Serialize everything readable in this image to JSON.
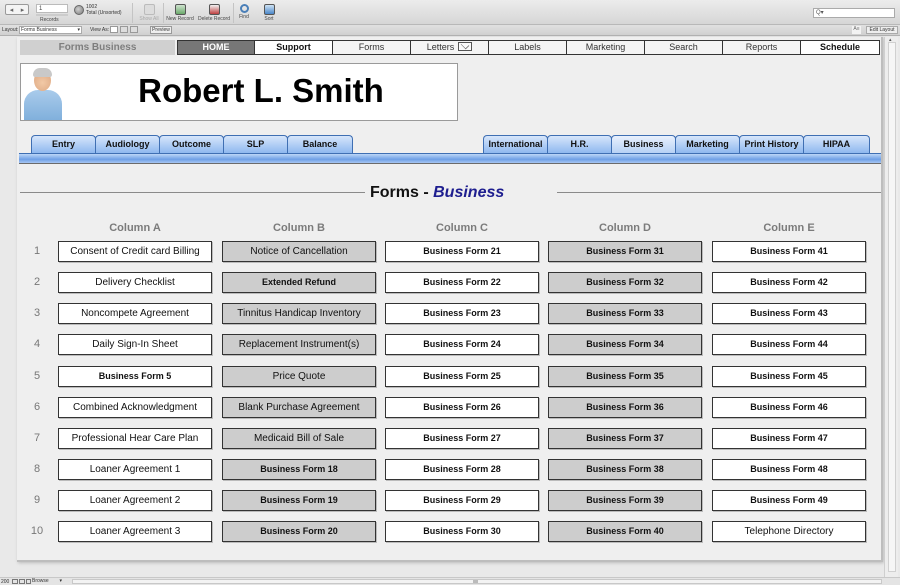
{
  "toolbar": {
    "record_number": "1",
    "records_label": "Records",
    "total_count": "1002",
    "total_status": "Total (Unsorted)",
    "buttons": [
      {
        "label": "Show All",
        "icon": "show-all-icon",
        "disabled": true
      },
      {
        "label": "New Record",
        "icon": "new-record-icon",
        "disabled": false
      },
      {
        "label": "Delete Record",
        "icon": "delete-record-icon",
        "disabled": false
      },
      {
        "label": "Find",
        "icon": "find-icon",
        "disabled": false
      },
      {
        "label": "Sort",
        "icon": "sort-icon",
        "disabled": false
      }
    ],
    "search_placeholder": "Q▾"
  },
  "layout_bar": {
    "layout_label": "Layout:",
    "layout_value": "Forms Business",
    "view_as_label": "View As:",
    "preview_label": "Preview",
    "aa_label": "A≡",
    "edit_layout_label": "Edit Layout"
  },
  "nav": {
    "title": "Forms Business",
    "items": [
      {
        "label": "HOME"
      },
      {
        "label": "Support"
      },
      {
        "label": "Forms"
      },
      {
        "label": "Letters"
      },
      {
        "label": "Labels"
      },
      {
        "label": "Marketing"
      },
      {
        "label": "Search"
      },
      {
        "label": "Reports"
      },
      {
        "label": "Schedule"
      }
    ]
  },
  "patient": {
    "name": "Robert L. Smith"
  },
  "tabs_left": [
    {
      "label": "Entry"
    },
    {
      "label": "Audiology"
    },
    {
      "label": "Outcome"
    },
    {
      "label": "SLP"
    },
    {
      "label": "Balance"
    }
  ],
  "tabs_right": [
    {
      "label": "International"
    },
    {
      "label": "H.R."
    },
    {
      "label": "Business",
      "active": true
    },
    {
      "label": "Marketing"
    },
    {
      "label": "Print History"
    },
    {
      "label": "HIPAA"
    }
  ],
  "section": {
    "title_prefix": "Forms - ",
    "title_accent": "Business",
    "accent_color": "#1e1e8f"
  },
  "grid": {
    "columns": [
      "Column A",
      "Column B",
      "Column C",
      "Column D",
      "Column E"
    ],
    "row_numbers": [
      "1",
      "2",
      "3",
      "4",
      "5",
      "6",
      "7",
      "8",
      "9",
      "10"
    ],
    "cells": [
      [
        "Consent of Credit card Billing",
        "Notice of Cancellation",
        "Business Form 21",
        "Business Form 31",
        "Business Form 41"
      ],
      [
        "Delivery Checklist",
        "Extended Refund",
        "Business Form 22",
        "Business Form 32",
        "Business Form 42"
      ],
      [
        "Noncompete Agreement",
        "Tinnitus Handicap Inventory",
        "Business Form 23",
        "Business Form 33",
        "Business Form 43"
      ],
      [
        "Daily Sign-In Sheet",
        "Replacement Instrument(s)",
        "Business Form 24",
        "Business Form 34",
        "Business Form 44"
      ],
      [
        "Business Form 5",
        "Price Quote",
        "Business Form 25",
        "Business Form 35",
        "Business Form 45"
      ],
      [
        "Combined Acknowledgment",
        "Blank Purchase Agreement",
        "Business Form 26",
        "Business Form 36",
        "Business Form 46"
      ],
      [
        "Professional Hear Care Plan",
        "Medicaid Bill of Sale",
        "Business Form 27",
        "Business Form 37",
        "Business Form 47"
      ],
      [
        "Loaner Agreement 1",
        "Business Form 18",
        "Business Form 28",
        "Business Form 38",
        "Business Form 48"
      ],
      [
        "Loaner Agreement 2",
        "Business Form 19",
        "Business Form 29",
        "Business Form 39",
        "Business Form 49"
      ],
      [
        "Loaner Agreement 3",
        "Business Form 20",
        "Business Form 30",
        "Business Form 40",
        "Telephone Directory"
      ]
    ],
    "bold_cells": [
      [
        false,
        false,
        true,
        true,
        true
      ],
      [
        false,
        true,
        true,
        true,
        true
      ],
      [
        false,
        false,
        true,
        true,
        true
      ],
      [
        false,
        false,
        true,
        true,
        true
      ],
      [
        true,
        false,
        true,
        true,
        true
      ],
      [
        false,
        false,
        true,
        true,
        true
      ],
      [
        false,
        false,
        true,
        true,
        true
      ],
      [
        false,
        true,
        true,
        true,
        true
      ],
      [
        false,
        true,
        true,
        true,
        true
      ],
      [
        false,
        true,
        true,
        true,
        false
      ]
    ]
  },
  "status_bar": {
    "zoom": "200",
    "mode": "Browse"
  }
}
